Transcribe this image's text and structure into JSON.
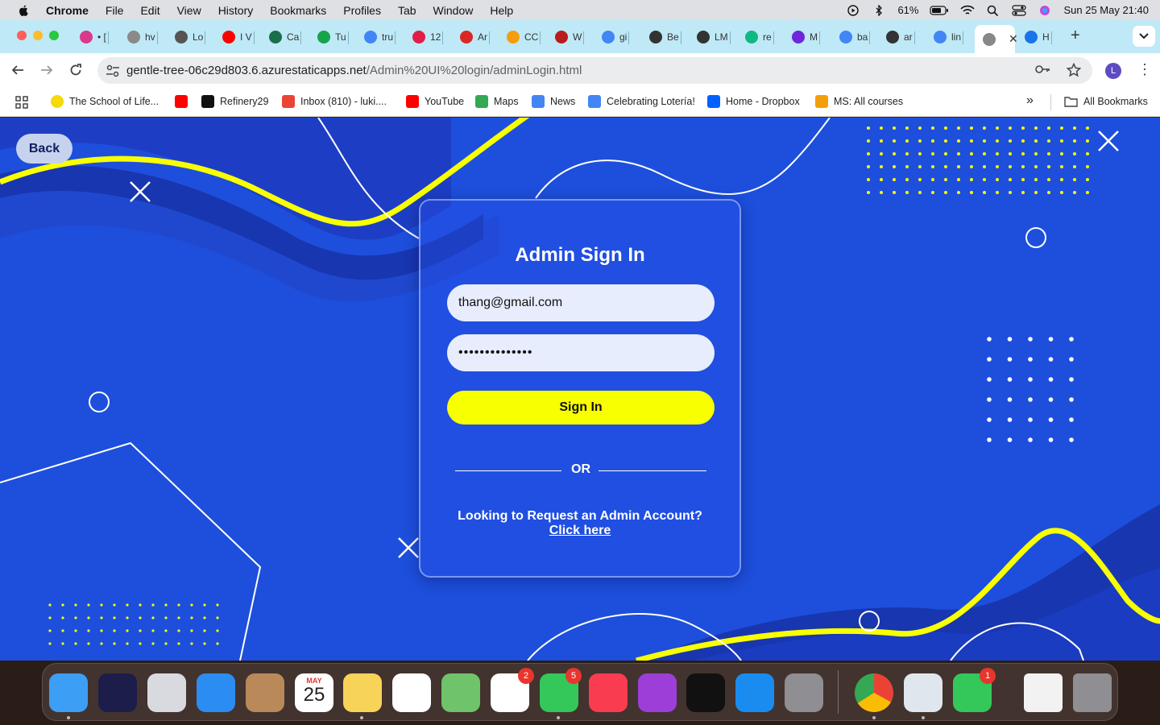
{
  "menubar": {
    "app_name": "Chrome",
    "items": [
      "File",
      "Edit",
      "View",
      "History",
      "Bookmarks",
      "Profiles",
      "Tab",
      "Window",
      "Help"
    ],
    "battery": "61%",
    "datetime": "Sun 25 May  21:40"
  },
  "tabs": [
    {
      "label": "• [",
      "color": "#d93a8a"
    },
    {
      "label": "hv",
      "color": "#8a8a8a"
    },
    {
      "label": "Lo",
      "color": "#555555"
    },
    {
      "label": "I V",
      "color": "#ff0000"
    },
    {
      "label": "Ca",
      "color": "#1a6e4c"
    },
    {
      "label": "Tu",
      "color": "#16a34a"
    },
    {
      "label": "tru",
      "color": "#4285f4"
    },
    {
      "label": "12",
      "color": "#e11d48"
    },
    {
      "label": "Ar",
      "color": "#dc2626"
    },
    {
      "label": "CC",
      "color": "#f59e0b"
    },
    {
      "label": "W",
      "color": "#b91c1c"
    },
    {
      "label": "gi",
      "color": "#4285f4"
    },
    {
      "label": "Be",
      "color": "#333333"
    },
    {
      "label": "LM",
      "color": "#333333"
    },
    {
      "label": "re",
      "color": "#10b981"
    },
    {
      "label": "M",
      "color": "#6d28d9"
    },
    {
      "label": "ba",
      "color": "#4285f4"
    },
    {
      "label": "ar",
      "color": "#333333"
    },
    {
      "label": "lin",
      "color": "#4285f4"
    },
    {
      "label": "",
      "color": "#888888",
      "active": true
    },
    {
      "label": "H",
      "color": "#1a73e8"
    }
  ],
  "toolbar": {
    "url_host": "gentle-tree-06c29d803.6.azurestaticapps.net",
    "url_path": "/Admin%20UI%20login/adminLogin.html",
    "profile_initial": "L"
  },
  "bookmarks": [
    {
      "label": "The School of Life...",
      "color": "#f5d90a"
    },
    {
      "label": "",
      "color": "#ff0000"
    },
    {
      "label": "Refinery29",
      "color": "#111111"
    },
    {
      "label": "Inbox (810) - luki....",
      "color": "#ea4335"
    },
    {
      "label": "YouTube",
      "color": "#ff0000"
    },
    {
      "label": "Maps",
      "color": "#34a853"
    },
    {
      "label": "News",
      "color": "#4285f4"
    },
    {
      "label": "Celebrating Lotería!",
      "color": "#4285f4"
    },
    {
      "label": "Home - Dropbox",
      "color": "#0061fe"
    },
    {
      "label": "MS: All courses",
      "color": "#f59e0b"
    }
  ],
  "all_bookmarks": "All Bookmarks",
  "page": {
    "back_label": "Back",
    "title": "Admin Sign In",
    "email_value": "thang@gmail.com",
    "password_value": "••••••••••••••",
    "signin_label": "Sign In",
    "or_label": "OR",
    "request_text": "Looking to Request an Admin Account?",
    "request_link": "Click here",
    "colors": {
      "background": "#1d4fdc",
      "accent": "#f8ff00",
      "field": "#e7edfd"
    }
  },
  "dock": {
    "calendar_month": "MAY",
    "calendar_day": "25",
    "messages_badge": "5",
    "photos_badge": "2",
    "facetime_badge": "1",
    "apps": [
      "finder",
      "siri",
      "launchpad",
      "mail",
      "contacts",
      "calendar",
      "notes",
      "reminders",
      "maps",
      "photos",
      "messages",
      "music",
      "podcasts",
      "tv",
      "app-store",
      "system-settings",
      "chrome",
      "preview",
      "facetime",
      "documents",
      "trash"
    ]
  }
}
